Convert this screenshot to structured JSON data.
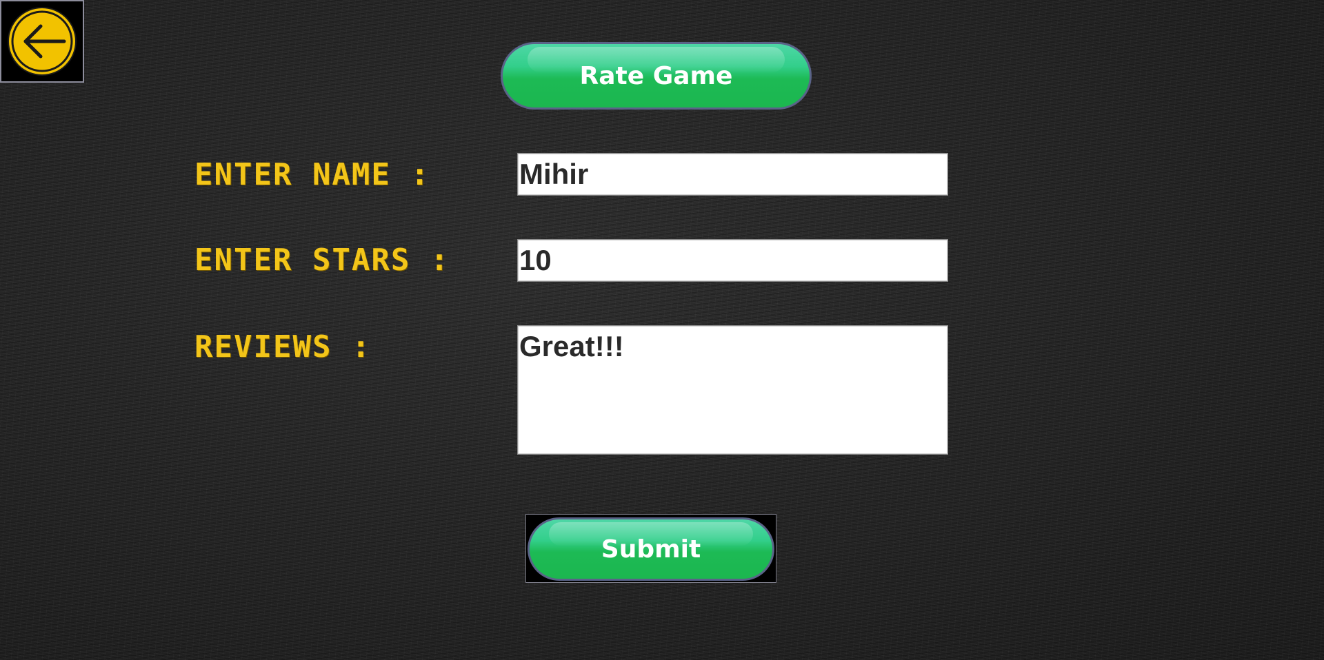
{
  "back_button": {
    "icon": "arrow-left-icon"
  },
  "header": {
    "title_label": "Rate Game"
  },
  "form": {
    "name_label": "ENTER NAME :",
    "name_value": "Mihir",
    "stars_label": "ENTER STARS :",
    "stars_value": "10",
    "reviews_label": "REVIEWS :",
    "reviews_value": "Great!!!",
    "submit_label": "Submit"
  },
  "colors": {
    "label_yellow": "#f3c519",
    "button_green": "#1dba55",
    "button_border": "#5a6388",
    "back_icon_yellow": "#f2c200"
  }
}
